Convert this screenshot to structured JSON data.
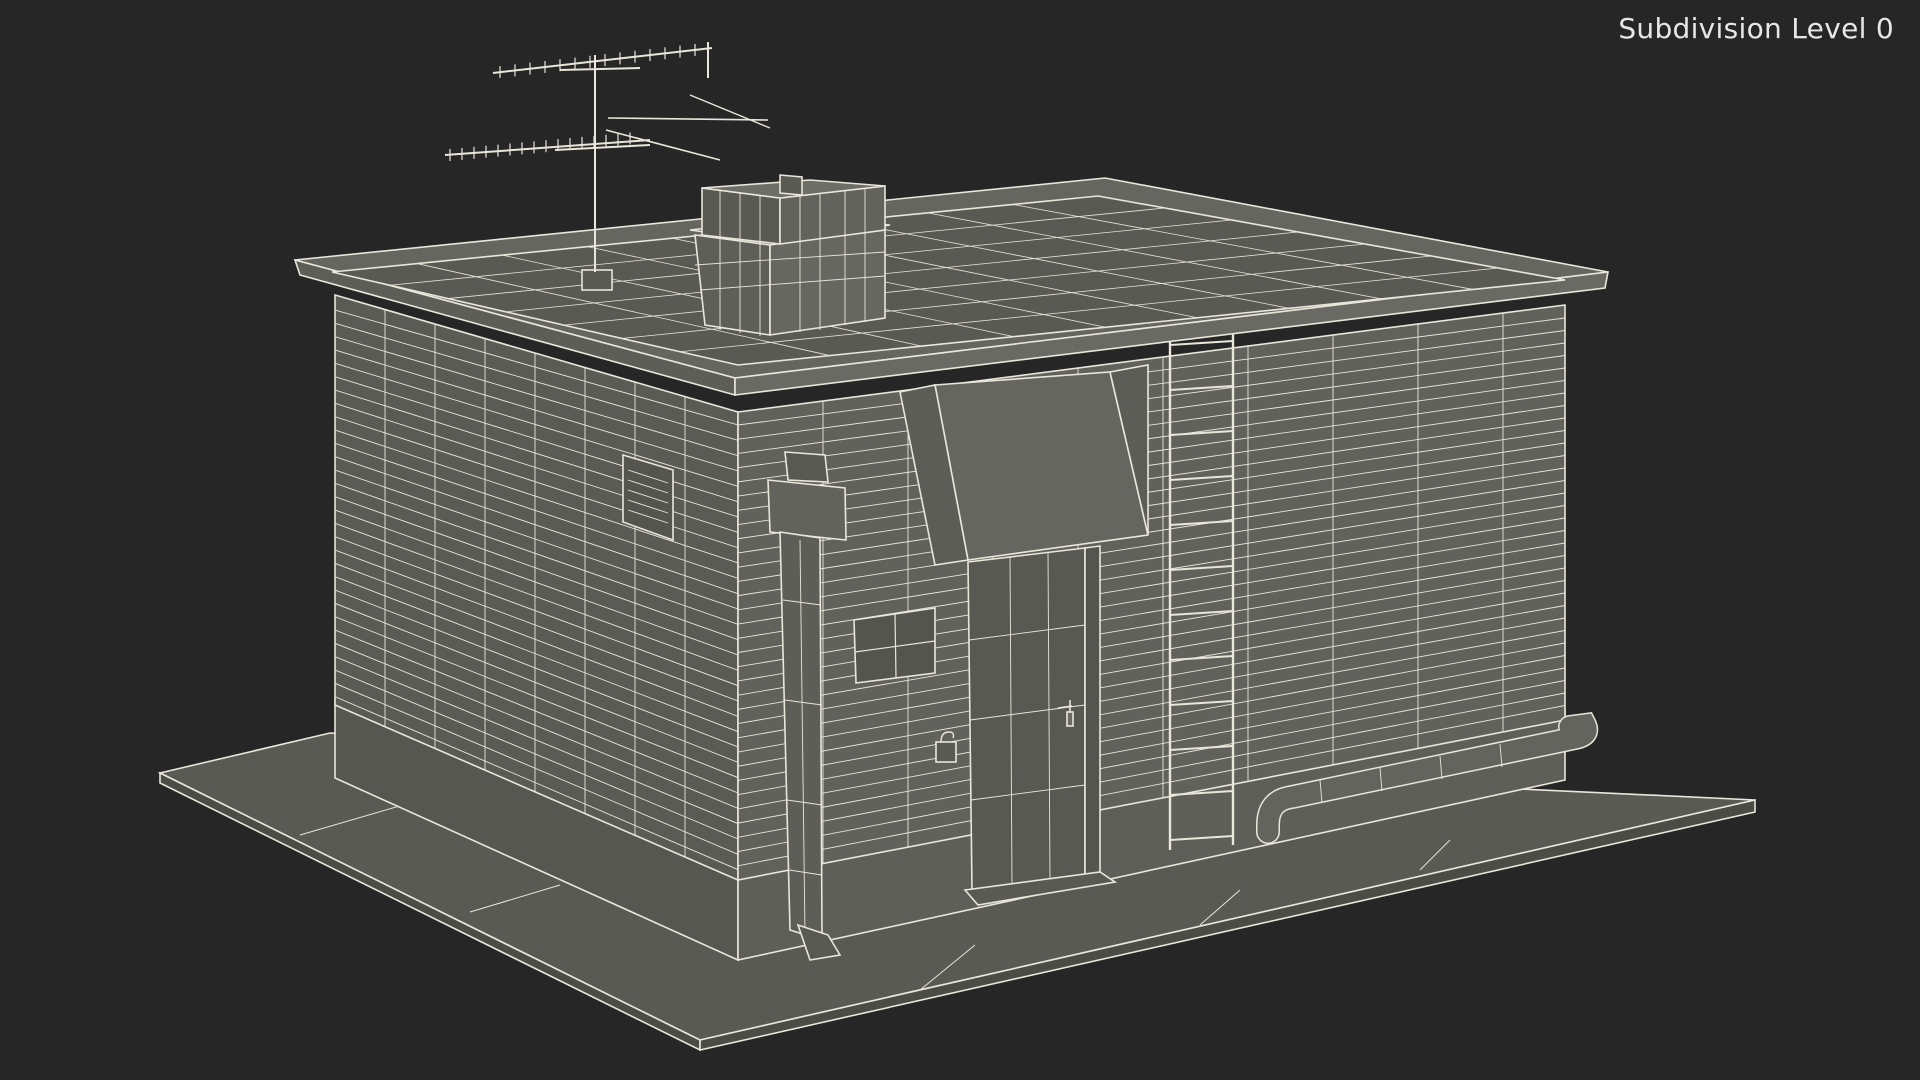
{
  "viewport": {
    "label": "Subdivision Level 0",
    "background": "#262626",
    "model_face_color": "#5d5d57",
    "model_face_dark": "#4f4f4a",
    "model_face_light": "#696963",
    "wire_color": "#e9e6da"
  }
}
